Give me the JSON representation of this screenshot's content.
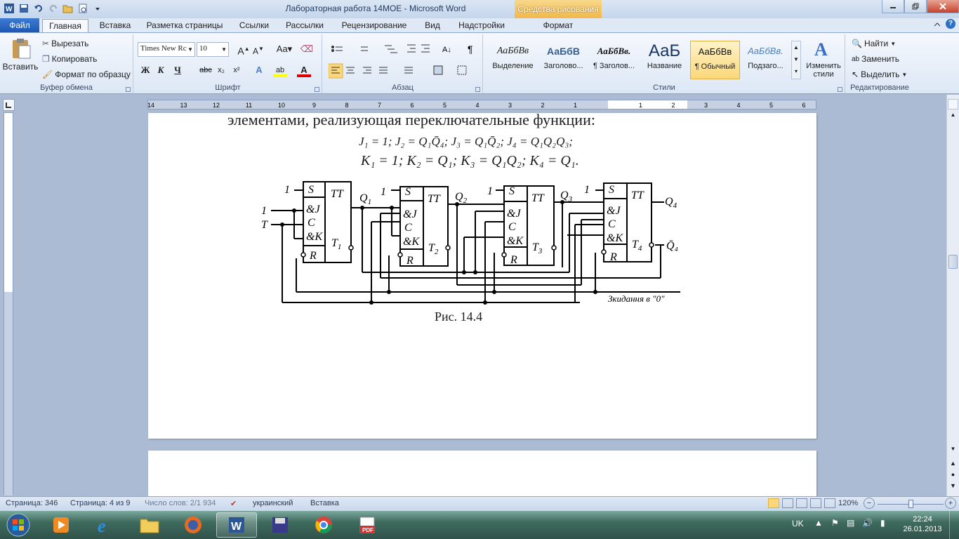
{
  "window": {
    "title": "Лабораторная работа 14МОЕ - Microsoft Word",
    "context_group": "Средства рисования"
  },
  "tabs": [
    {
      "label": "Файл"
    },
    {
      "label": "Главная"
    },
    {
      "label": "Вставка"
    },
    {
      "label": "Разметка страницы"
    },
    {
      "label": "Ссылки"
    },
    {
      "label": "Рассылки"
    },
    {
      "label": "Рецензирование"
    },
    {
      "label": "Вид"
    },
    {
      "label": "Надстройки"
    },
    {
      "label": "Формат"
    }
  ],
  "clipboard": {
    "paste": "Вставить",
    "cut": "Вырезать",
    "copy": "Копировать",
    "format_painter": "Формат по образцу",
    "group": "Буфер обмена"
  },
  "font": {
    "name": "Times New Rc",
    "size": "10",
    "bold": "Ж",
    "italic": "К",
    "underline": "Ч",
    "group": "Шрифт"
  },
  "paragraph": {
    "group": "Абзац"
  },
  "styles": {
    "group": "Стили",
    "items": [
      {
        "sample": "АаБбВв",
        "name": "Выделение"
      },
      {
        "sample": "АаБбВ",
        "name": "Заголово..."
      },
      {
        "sample": "АаБбВв.",
        "name": "¶ Заголов..."
      },
      {
        "sample": "АаБ",
        "name": "Название"
      },
      {
        "sample": "АаБбВв",
        "name": "¶ Обычный"
      },
      {
        "sample": "АаБбВв.",
        "name": "Подзаго..."
      }
    ],
    "change": "Изменить стили"
  },
  "editing": {
    "find": "Найти",
    "replace": "Заменить",
    "select": "Выделить",
    "group": "Редактирование"
  },
  "ruler_numbers": [
    "14",
    "13",
    "12",
    "11",
    "10",
    "9",
    "8",
    "7",
    "6",
    "5",
    "4",
    "3",
    "2",
    "1",
    "1",
    "2",
    "3",
    "4",
    "5",
    "6"
  ],
  "document": {
    "heading_line": "элементами, реализующая переключательные функции:",
    "formula_j": "J₁ = 1;  J₂ = Q₁Q̄₄;  J₃ = Q₁Q̄₂;  J₄ = Q₁Q₂Q₃;",
    "formula_k": "K₁ = 1;  K₂ = Q₁;  K₃ = Q₁Q₂;  K₄ = Q₁.",
    "circuit": {
      "inputs": [
        "1",
        "1",
        "T"
      ],
      "flipflops": [
        {
          "pins": [
            "S",
            "&J",
            "C",
            "&K",
            "R"
          ],
          "type": "TT",
          "name": "T",
          "sub": "1",
          "q": "Q",
          "q_sub": "1"
        },
        {
          "pins": [
            "S",
            "&J",
            "C",
            "&K",
            "R"
          ],
          "type": "TT",
          "name": "T",
          "sub": "2",
          "q": "Q",
          "q_sub": "2"
        },
        {
          "pins": [
            "S",
            "&J",
            "C",
            "&K",
            "R"
          ],
          "type": "TT",
          "name": "T",
          "sub": "3",
          "q": "Q",
          "q_sub": "3"
        },
        {
          "pins": [
            "S",
            "&J",
            "C",
            "&K",
            "R"
          ],
          "type": "TT",
          "name": "T",
          "sub": "4",
          "q": "Q",
          "q_sub": "4"
        }
      ],
      "s_inputs": [
        "1",
        "1",
        "1",
        "1"
      ],
      "qbar_label": "Q̄₄",
      "reset_label": "Зкидання в \"0\""
    },
    "caption": "Рис. 14.4"
  },
  "status": {
    "page": "Страница: 346",
    "page_of": "Страница: 4 из 9",
    "words": "Число слов: 2/1 934",
    "language": "украинский",
    "mode": "Вставка",
    "zoom": "120%"
  },
  "tray": {
    "lang": "UK",
    "time": "22:24",
    "date": "26.01.2013"
  }
}
